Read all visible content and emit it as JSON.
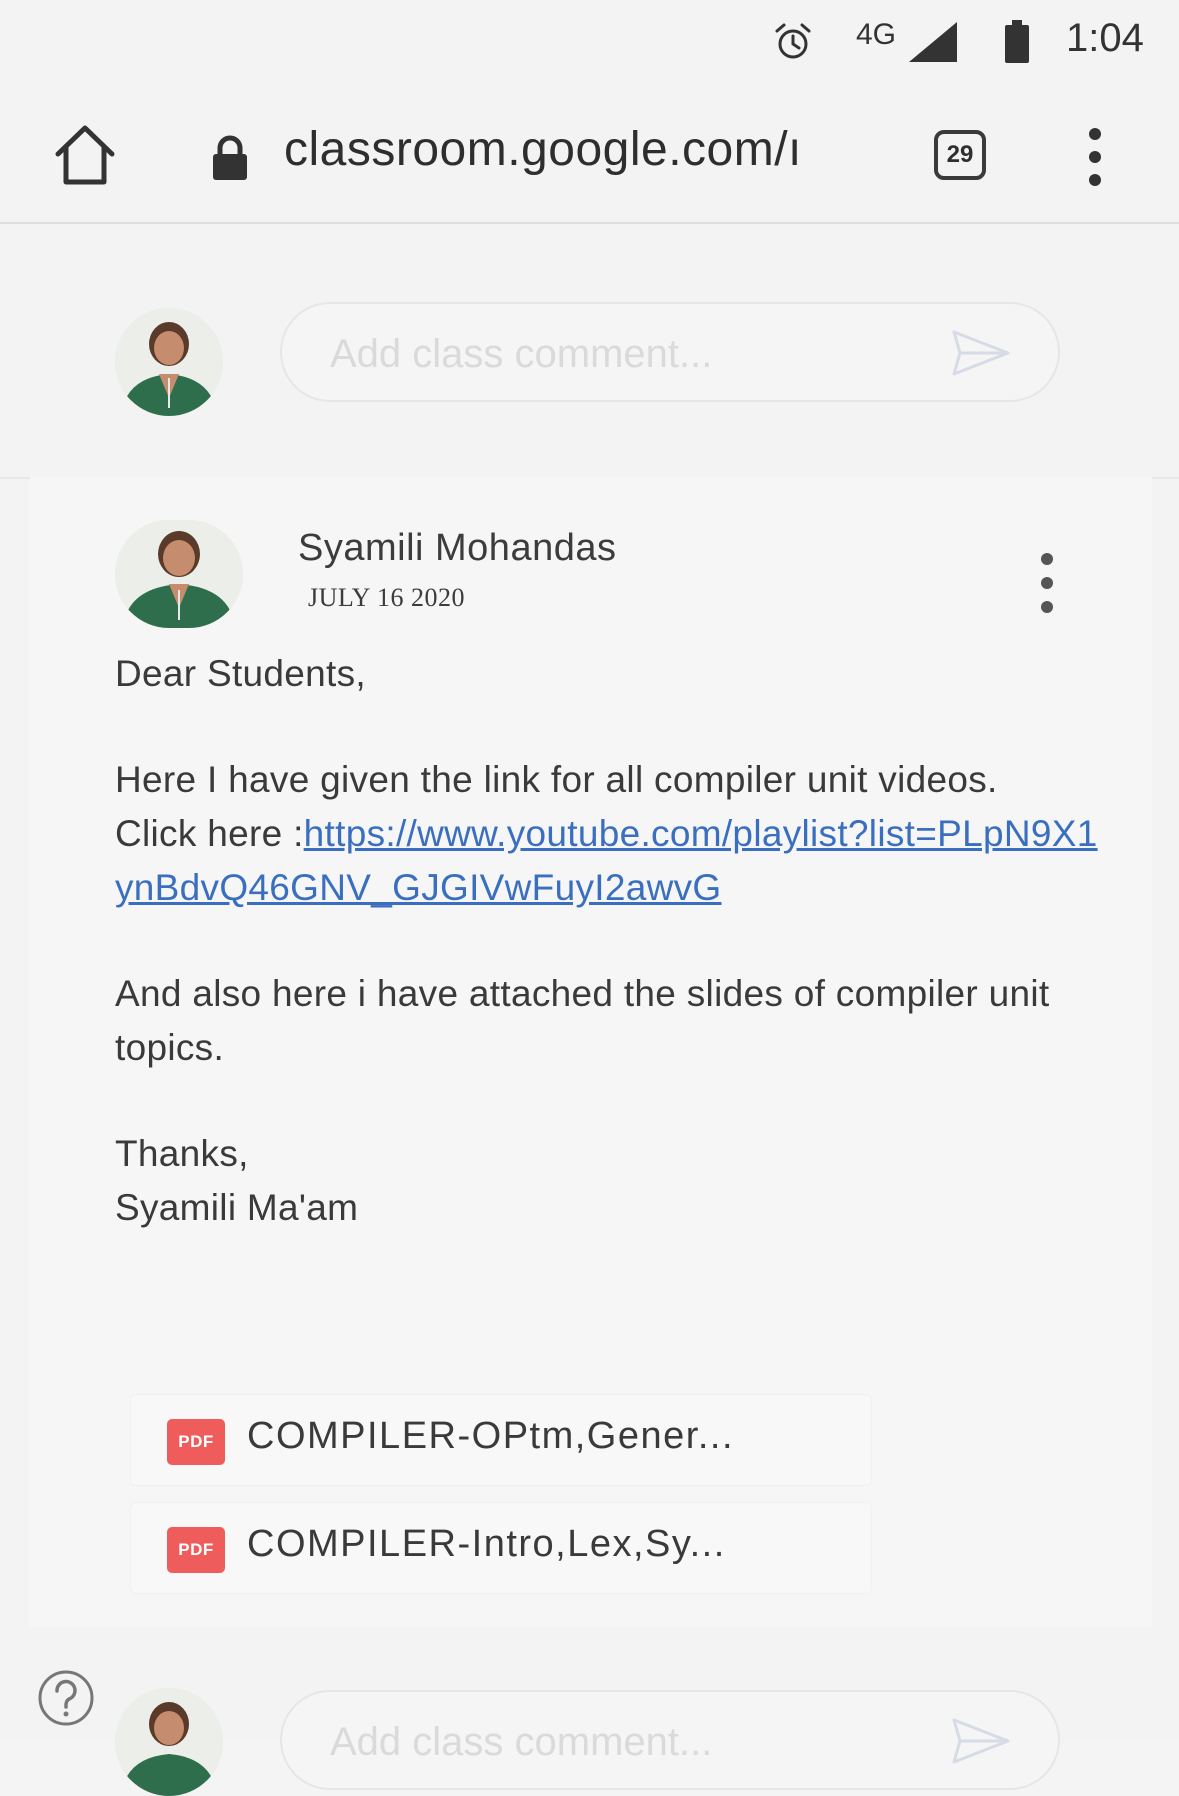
{
  "status_bar": {
    "network": "4G",
    "time": "1:04"
  },
  "browser": {
    "url": "classroom.google.com/ı",
    "tab_count": "29"
  },
  "comment_box": {
    "placeholder": "Add class comment..."
  },
  "post": {
    "author": "Syamili Mohandas",
    "date": "JULY 16 2020",
    "greeting": "Dear Students,",
    "line1": "Here I have given the link for all compiler unit videos.",
    "link_prefix": "Click here :",
    "link_text": "https://www.youtube.com/playlist?list=PLpN9X1ynBdvQ46GNV_GJGIVwFuyI2awvG",
    "line2": "And also here i have attached the slides of compiler unit topics.",
    "signoff": "Thanks,",
    "signature": "Syamili Ma'am",
    "attachments": [
      {
        "type": "PDF",
        "name": "COMPILER-OPtm,Gener..."
      },
      {
        "type": "PDF",
        "name": "COMPILER-Intro,Lex,Sy..."
      }
    ]
  },
  "bottom_comment_box": {
    "placeholder": "Add class comment..."
  },
  "colors": {
    "link": "#3a6fc0",
    "pdf_badge": "#ee5c5c",
    "avatar_shirt": "#2f6e4c"
  },
  "icons": [
    "alarm-icon",
    "signal-icon",
    "battery-icon",
    "home-icon",
    "lock-icon",
    "tabs-icon",
    "overflow-menu-icon",
    "send-icon",
    "pdf-icon",
    "help-icon"
  ]
}
